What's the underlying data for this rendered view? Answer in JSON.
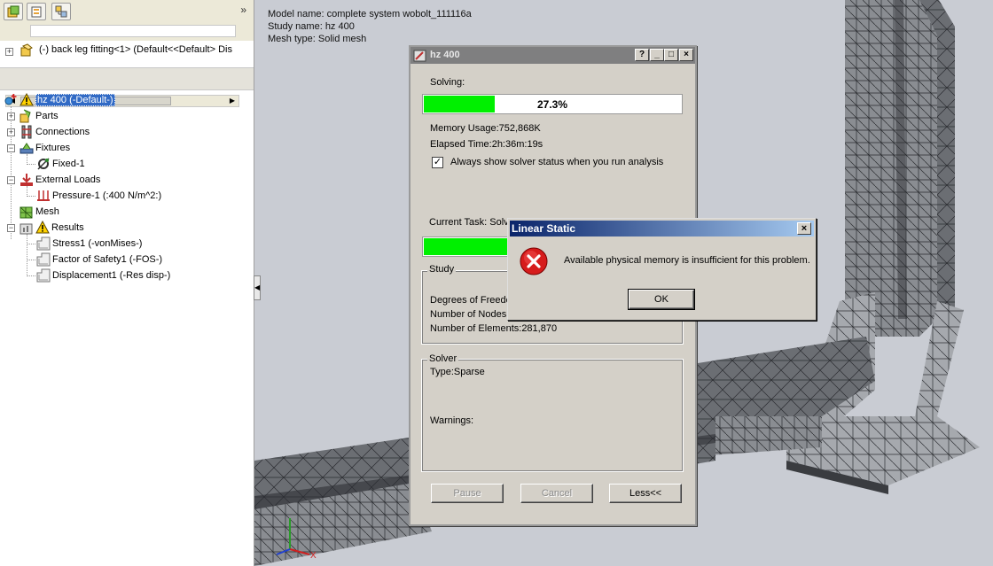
{
  "panel": {
    "expand_chevron": "»",
    "flyout_text": "(-) back leg fitting<1> (Default<<Default> Dis",
    "tree": [
      {
        "label": "hz 400 (-Default-)",
        "icon": "study-warning-icon"
      },
      {
        "label": "Parts",
        "icon": "parts-icon"
      },
      {
        "label": "Connections",
        "icon": "connections-icon"
      },
      {
        "label": "Fixtures",
        "icon": "fixtures-icon"
      },
      {
        "label": "Fixed-1",
        "icon": "fixed-geometry-icon"
      },
      {
        "label": "External Loads",
        "icon": "external-loads-icon"
      },
      {
        "label": "Pressure-1 (:400 N/m^2:)",
        "icon": "pressure-icon"
      },
      {
        "label": "Mesh",
        "icon": "mesh-icon"
      },
      {
        "label": "Results",
        "icon": "results-warning-icon"
      },
      {
        "label": "Stress1 (-vonMises-)",
        "icon": "plot-icon"
      },
      {
        "label": "Factor of Safety1 (-FOS-)",
        "icon": "plot-icon"
      },
      {
        "label": "Displacement1 (-Res disp-)",
        "icon": "plot-icon"
      }
    ]
  },
  "model_info": {
    "model_name": "Model name: complete system wobolt_111116a",
    "study_name": "Study name: hz 400",
    "mesh_type": "Mesh type: Solid mesh"
  },
  "solver_dialog": {
    "title": "hz 400",
    "title_buttons": {
      "help": "?",
      "minimize": "_",
      "maximize": "□",
      "close": "×"
    },
    "solving_label": "Solving:",
    "progress_text": "27.3%",
    "progress_value": 0.273,
    "memory_usage": "Memory Usage:752,868K",
    "elapsed_time": "Elapsed Time:2h:36m:19s",
    "always_show_label": "Always show solver status when you run analysis",
    "always_show_checked": true,
    "current_task": "Current Task: Solv",
    "task_progress_value": 0.34,
    "study_group_title": "Study",
    "degrees_of_freedom": "Degrees of Freedo",
    "number_of_nodes": "Number of Nodes:",
    "number_of_elements": "Number of Elements:281,870",
    "solver_group_title": "Solver",
    "solver_type": "Type:Sparse",
    "warnings_label": "Warnings:",
    "pause_label": "Pause",
    "cancel_label": "Cancel",
    "less_label": "Less<<"
  },
  "error_dialog": {
    "title": "Linear Static",
    "close_label": "×",
    "message": "Available physical memory is insufficient for this problem.",
    "ok_label": "OK"
  },
  "colors": {
    "progress_fill": "#00f000",
    "error_title_start": "#0a246a",
    "selection": "#316ac5"
  }
}
